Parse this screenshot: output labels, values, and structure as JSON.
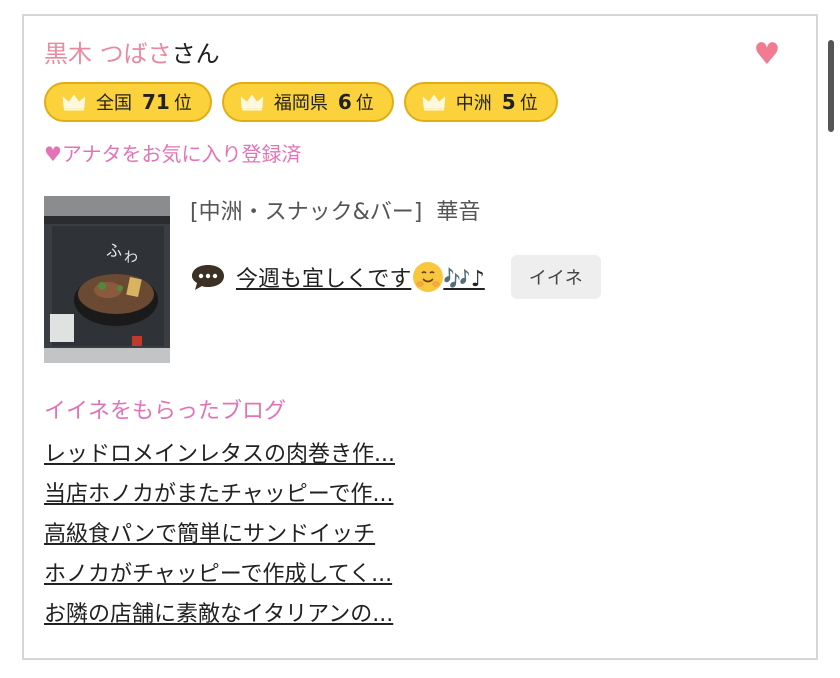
{
  "user": {
    "name": "黒木 つばさ",
    "honorific": "さん",
    "favorite_icon": "heart-icon",
    "favorite_status": "♥アナタをお気に入り登録済"
  },
  "rankings": [
    {
      "label": "全国",
      "rank": "71",
      "unit": "位"
    },
    {
      "label": "福岡県",
      "rank": "6",
      "unit": "位"
    },
    {
      "label": "中洲",
      "rank": "5",
      "unit": "位"
    }
  ],
  "post": {
    "shop_category": "[中洲・スナック&バー]",
    "shop_name": "華音",
    "text": "今週も宜しくです",
    "notes": "🎶♪",
    "like_button": "イイネ"
  },
  "blog": {
    "heading": "イイネをもらったブログ",
    "items": [
      "レッドロメインレタスの肉巻き作...",
      "当店ホノカがまたチャッピーで作...",
      "高級食パンで簡単にサンドイッチ",
      "ホノカがチャッピーで作成してく...",
      "お隣の店舗に素敵なイタリアンの..."
    ]
  },
  "colors": {
    "name": "#e88ba0",
    "accent_pink": "#e373b6",
    "heart": "#f07b93",
    "badge_fill": "#fbd23c",
    "badge_border": "#e2ad12"
  }
}
